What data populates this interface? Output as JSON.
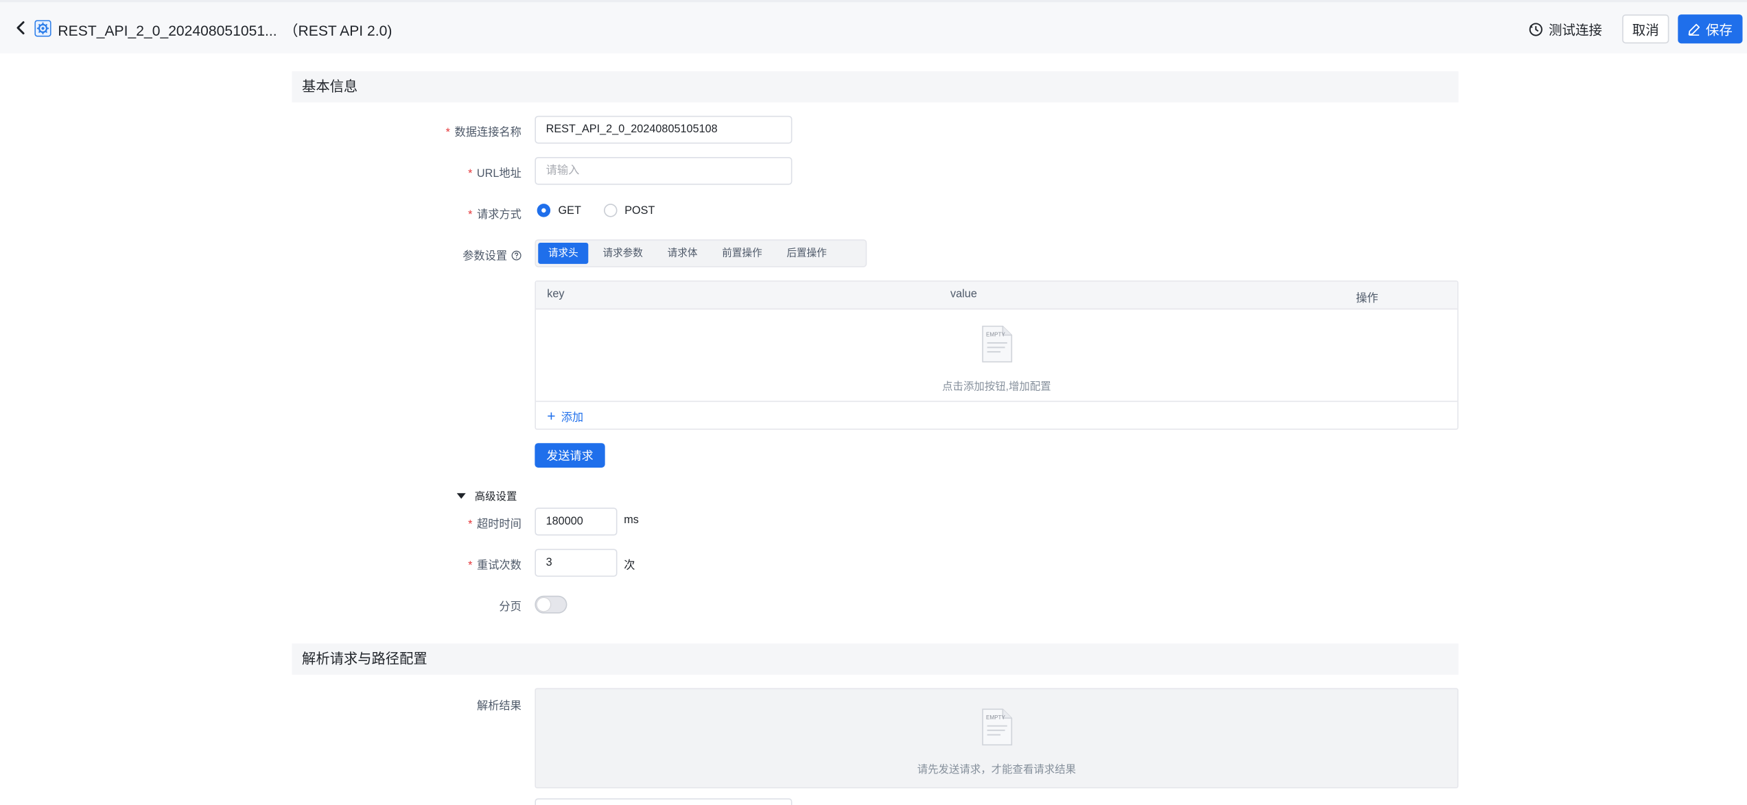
{
  "header": {
    "title": "REST_API_2_0_202408051051...",
    "type": "（REST API 2.0)",
    "test_label": "测试连接",
    "cancel_label": "取消",
    "save_label": "保存"
  },
  "sections": {
    "basic": "基本信息",
    "parse": "解析请求与路径配置"
  },
  "form": {
    "name_label": "数据连接名称",
    "name_value": "REST_API_2_0_20240805105108",
    "url_label": "URL地址",
    "url_placeholder": "请输入",
    "method_label": "请求方式",
    "methods": [
      "GET",
      "POST"
    ],
    "selected_method": "GET",
    "params_label": "参数设置",
    "tabs": [
      "请求头",
      "请求参数",
      "请求体",
      "前置操作",
      "后置操作"
    ],
    "active_tab": "请求头",
    "table": {
      "columns": [
        "key",
        "value",
        "操作"
      ],
      "empty_text": "点击添加按钮,增加配置",
      "add_label": "添加"
    },
    "send_label": "发送请求",
    "advanced_label": "高级设置",
    "timeout_label": "超时时间",
    "timeout_value": "180000",
    "timeout_unit": "ms",
    "retry_label": "重试次数",
    "retry_value": "3",
    "retry_unit": "次",
    "paging_label": "分页",
    "paging_enabled": false,
    "result_label": "解析结果",
    "result_empty": "请先发送请求，才能查看请求结果"
  },
  "colors": {
    "primary": "#1f6feb",
    "required": "#e5383b"
  }
}
